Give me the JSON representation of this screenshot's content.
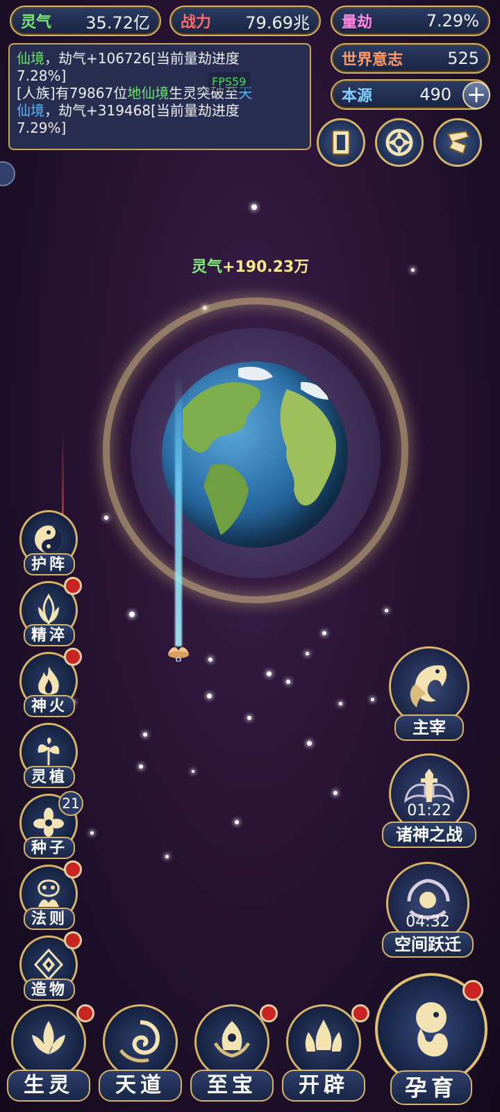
{
  "stats": {
    "lingqi": {
      "label": "灵气",
      "value": "35.72亿",
      "color": "#7be86f"
    },
    "zhanli": {
      "label": "战力",
      "value": "79.69兆",
      "color": "#ff6a6a"
    },
    "liangjie": {
      "label": "量劫",
      "value": "7.29%",
      "color": "#ff86e0"
    },
    "shijie": {
      "label": "世界意志",
      "value": "525",
      "color": "#ff9a66"
    },
    "benyuan": {
      "label": "本源",
      "value": "490",
      "color": "#86d2ff"
    }
  },
  "log": {
    "line1_green": "仙境",
    "line1_rest": "，劫气+106726[当前量劫进度",
    "line2": "7.28%]",
    "line3_pre": "[人族]有79867位",
    "line3_green": "地仙境",
    "line3_mid": "生灵突破至",
    "line3_blue": "天",
    "line4_blue": "仙境",
    "line4_rest": "，劫气+319468[当前量劫进度",
    "line5": "7.29%]"
  },
  "fps": "FPS59",
  "floating": {
    "key": "灵气",
    "value": "+190.23万"
  },
  "left_menu": [
    {
      "label": "护阵",
      "icon": "yin-yang-icon",
      "dot": false,
      "badge": ""
    },
    {
      "label": "精淬",
      "icon": "flame-lotus-icon",
      "dot": true,
      "badge": ""
    },
    {
      "label": "神火",
      "icon": "fire-icon",
      "dot": true,
      "badge": ""
    },
    {
      "label": "灵植",
      "icon": "plant-icon",
      "dot": false,
      "badge": ""
    },
    {
      "label": "种子",
      "icon": "flower-icon",
      "dot": false,
      "badge": "21"
    },
    {
      "label": "法则",
      "icon": "rune-icon",
      "dot": true,
      "badge": ""
    },
    {
      "label": "造物",
      "icon": "diamond-icon",
      "dot": true,
      "badge": ""
    }
  ],
  "right_menu": {
    "zhuzai": {
      "label": "主宰",
      "icon": "dragon-icon"
    },
    "zhushen": {
      "label": "诸神之战",
      "icon": "sword-wings-icon",
      "timer": "01:22"
    },
    "kongjian": {
      "label": "空间跃迁",
      "icon": "vortex-icon",
      "timer": "04:32"
    }
  },
  "bottom_menu": [
    {
      "label": "生灵",
      "icon": "lotus-icon",
      "dot": true
    },
    {
      "label": "天道",
      "icon": "swirl-icon",
      "dot": false
    },
    {
      "label": "至宝",
      "icon": "treasure-icon",
      "dot": true
    },
    {
      "label": "开辟",
      "icon": "flames-icon",
      "dot": true
    }
  ],
  "yunyu": {
    "label": "孕育",
    "icon": "embryo-icon",
    "dot": true
  },
  "top_buttons": [
    "card-icon",
    "portal-icon",
    "scroll-icon"
  ]
}
